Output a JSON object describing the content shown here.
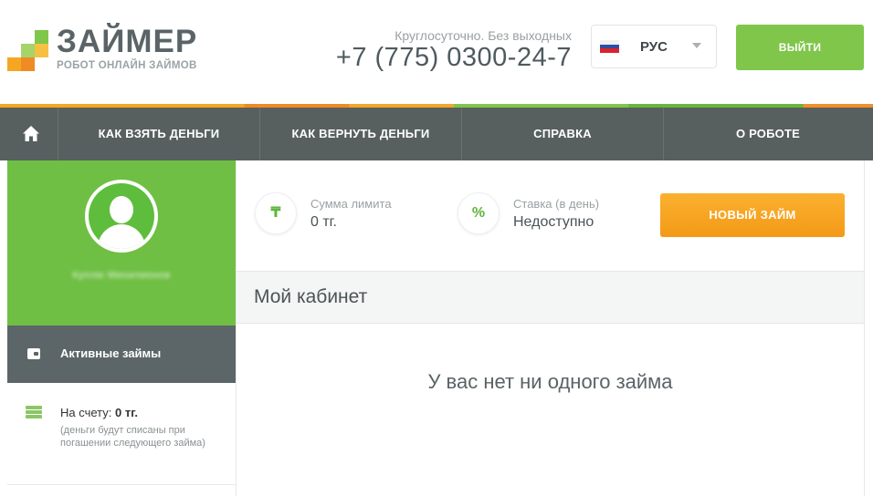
{
  "header": {
    "brand_title": "ЗАЙМЕР",
    "brand_subtitle": "РОБОТ ОНЛАЙН ЗАЙМОВ",
    "hours_note": "Круглосуточно. Без выходных",
    "phone": "+7 (775) 0300-24-7",
    "language": "РУС",
    "logout_label": "ВЫЙТИ",
    "colors": {
      "green": "#7fc64a",
      "orange": "#f5a623",
      "dark": "#57605e"
    }
  },
  "nav": {
    "home_icon": "home-icon",
    "items": [
      {
        "label": "КАК ВЗЯТЬ ДЕНЬГИ"
      },
      {
        "label": "КАК ВЕРНУТЬ ДЕНЬГИ"
      },
      {
        "label": "СПРАВКА"
      },
      {
        "label": "О РОБОТЕ"
      }
    ]
  },
  "sidebar": {
    "user_name": "Куплю Михилионов",
    "active_item": "Активные займы",
    "balance_label": "На счету:",
    "balance_value": "0 тг.",
    "balance_note": "(деньги будут списаны при погашении следующего займа)"
  },
  "stats": {
    "limit_icon": "₸",
    "limit_label": "Сумма лимита",
    "limit_value": "0 тг.",
    "rate_icon": "%",
    "rate_label": "Ставка (в день)",
    "rate_value": "Недоступно",
    "new_loan_label": "НОВЫЙ ЗАЙМ"
  },
  "main": {
    "cabinet_title": "Мой кабинет",
    "empty_message": "У вас нет ни одного займа"
  }
}
